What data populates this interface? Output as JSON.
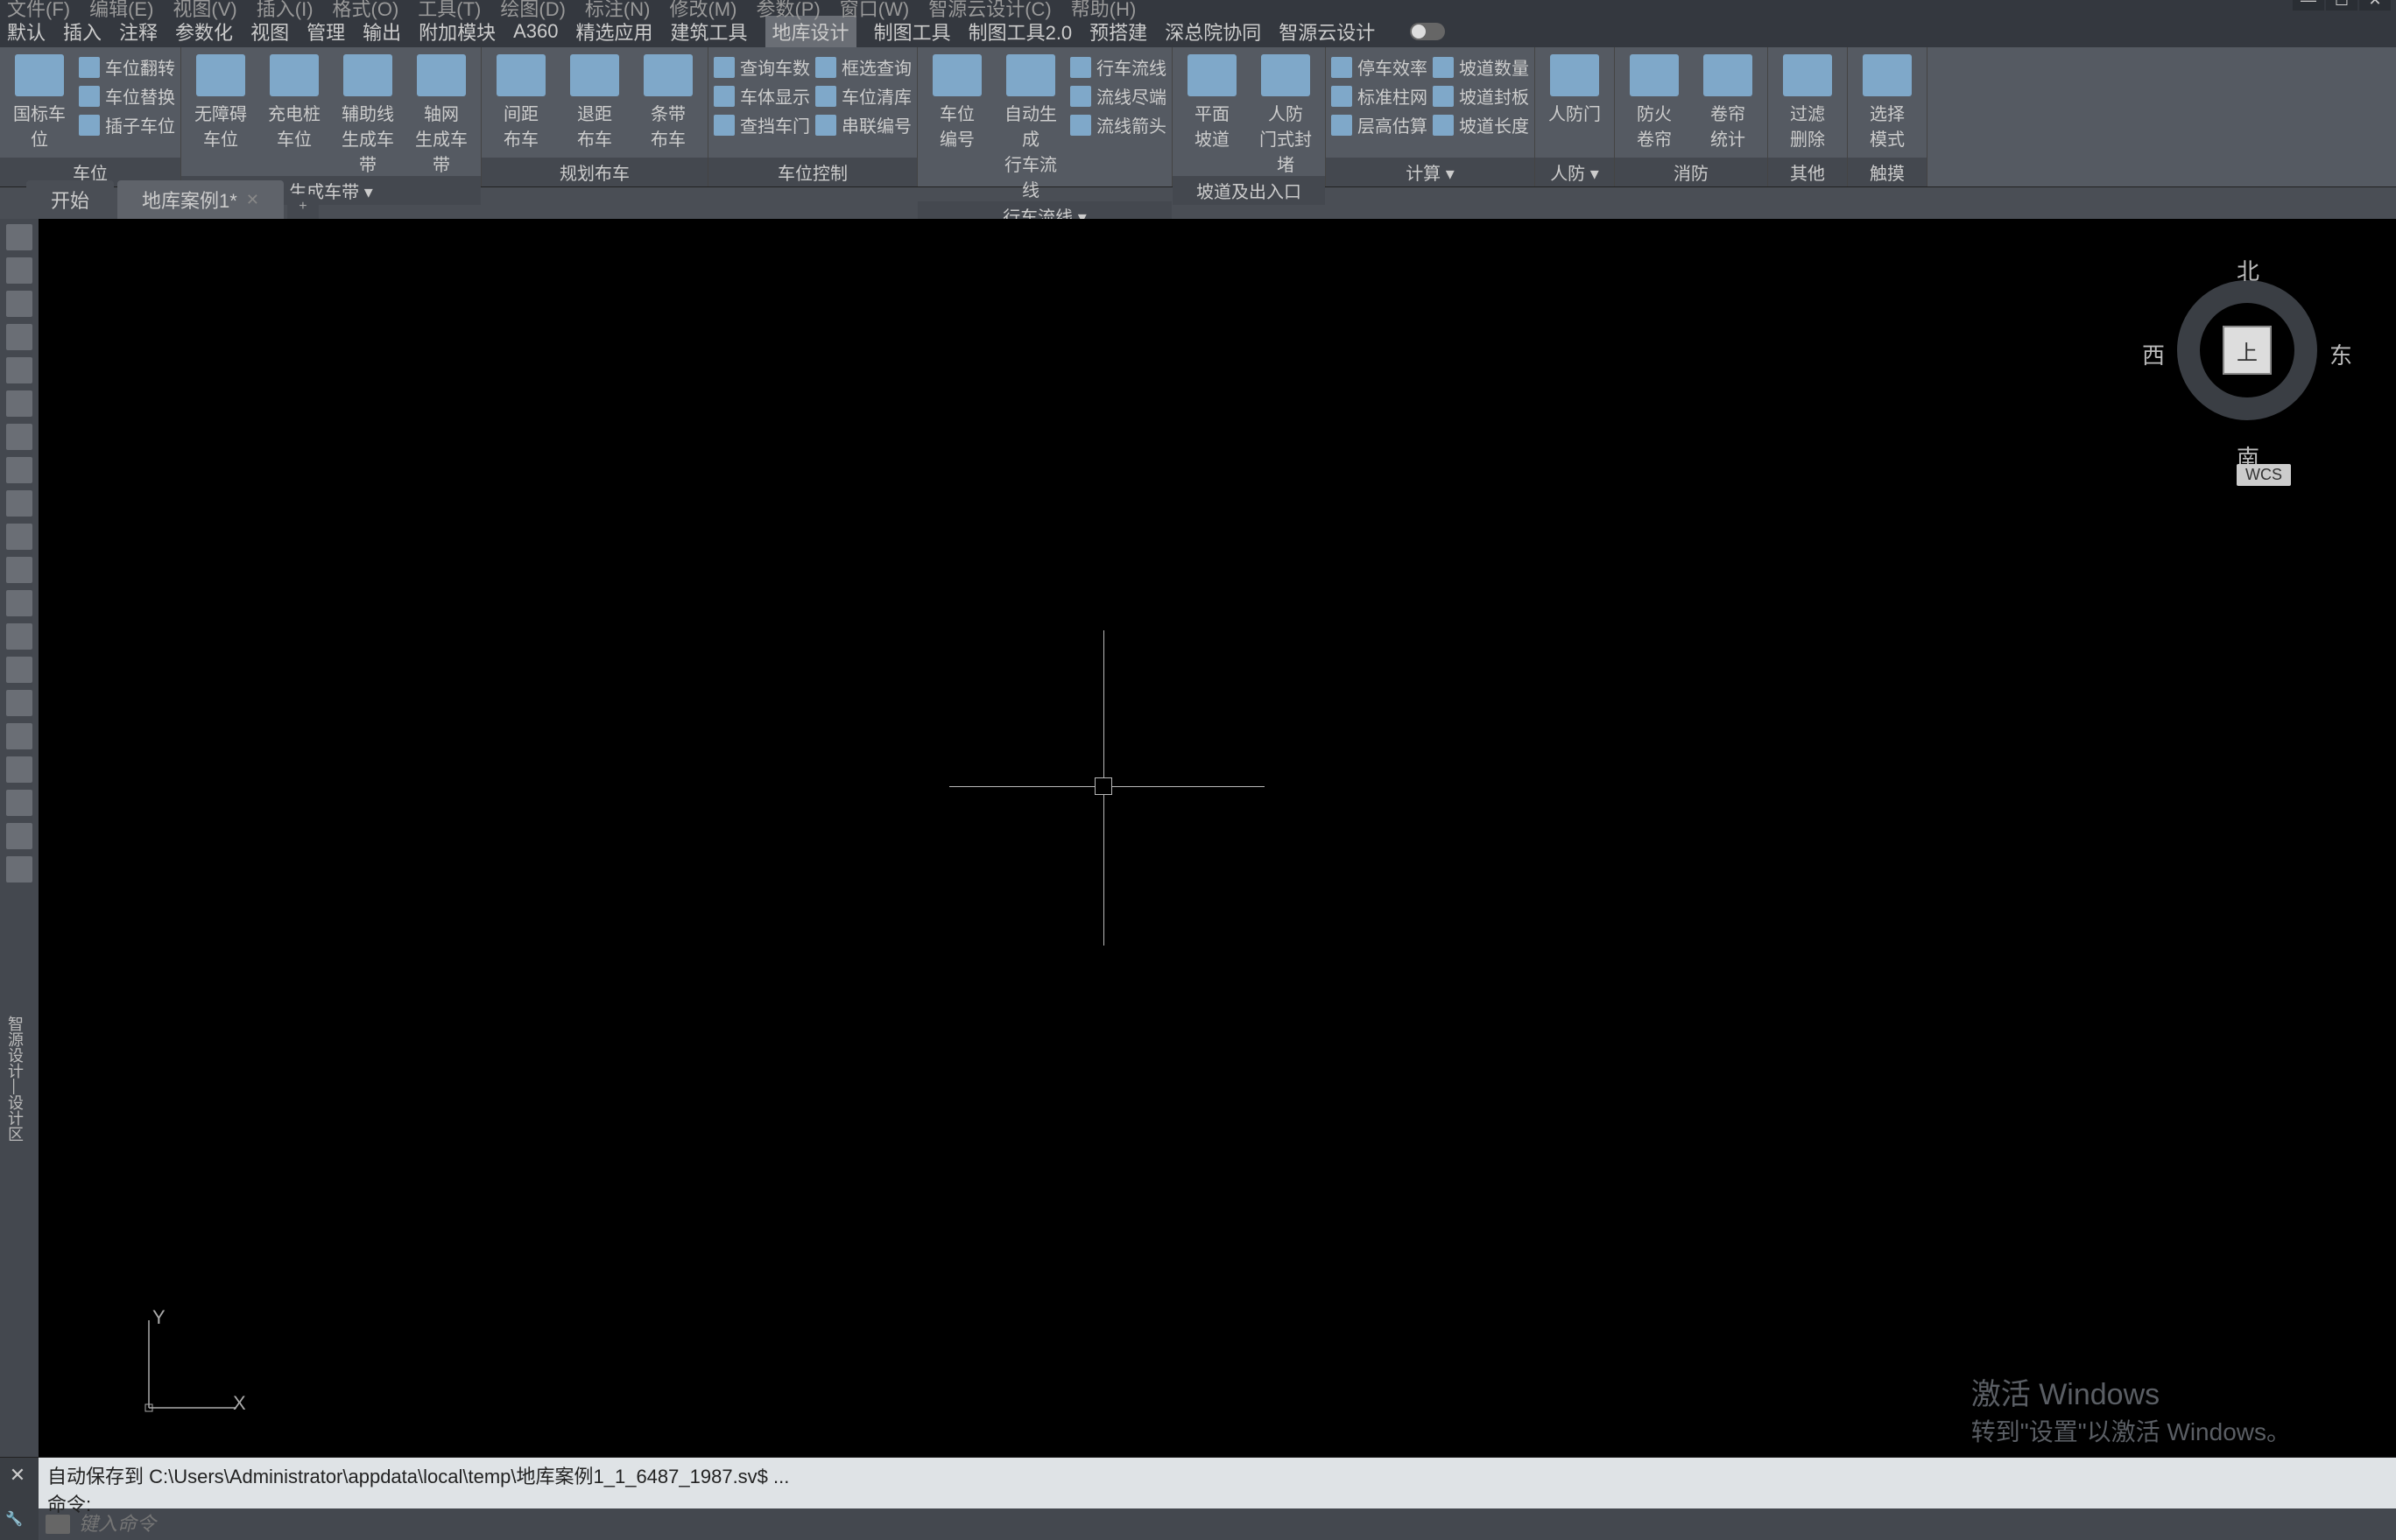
{
  "top_menu": [
    "文件(F)",
    "编辑(E)",
    "视图(V)",
    "插入(I)",
    "格式(O)",
    "工具(T)",
    "绘图(D)",
    "标注(N)",
    "修改(M)",
    "参数(P)",
    "窗口(W)",
    "智源云设计(C)",
    "帮助(H)"
  ],
  "ribbon_tabs": [
    "默认",
    "插入",
    "注释",
    "参数化",
    "视图",
    "管理",
    "输出",
    "附加模块",
    "A360",
    "精选应用",
    "建筑工具",
    "地库设计",
    "制图工具",
    "制图工具2.0",
    "预搭建",
    "深总院协同",
    "智源云设计"
  ],
  "active_ribbon_tab": "地库设计",
  "panels": [
    {
      "title": "车位",
      "big": [
        {
          "label": "国标车位"
        }
      ],
      "small": [
        [
          "车位翻转",
          "车位替换",
          "插子车位"
        ]
      ]
    },
    {
      "title": "生成车带 ▾",
      "big": [
        {
          "label": "无障碍\n车位"
        },
        {
          "label": "充电桩\n车位"
        },
        {
          "label": "辅助线\n生成车带"
        },
        {
          "label": "轴网\n生成车带"
        }
      ],
      "small": []
    },
    {
      "title": "规划布车",
      "big": [
        {
          "label": "间距\n布车"
        },
        {
          "label": "退距\n布车"
        },
        {
          "label": "条带\n布车"
        }
      ],
      "small": []
    },
    {
      "title": "车位控制",
      "big": [],
      "small": [
        [
          "查询车数",
          "车体显示",
          "查挡车门"
        ],
        [
          "框选查询",
          "车位清库",
          "串联编号"
        ]
      ]
    },
    {
      "title": "行车流线 ▾",
      "big": [
        {
          "label": "车位\n编号"
        },
        {
          "label": "自动生成\n行车流线"
        }
      ],
      "small": [
        [
          "行车流线",
          "流线尽端",
          "流线箭头"
        ]
      ]
    },
    {
      "title": "坡道及出入口",
      "big": [
        {
          "label": "平面\n坡道"
        },
        {
          "label": "人防\n门式封堵"
        }
      ],
      "small": []
    },
    {
      "title": "计算 ▾",
      "big": [],
      "small": [
        [
          "停车效率",
          "标准柱网",
          "层高估算"
        ],
        [
          "坡道数量",
          "坡道封板",
          "坡道长度"
        ]
      ]
    },
    {
      "title": "人防 ▾",
      "big": [
        {
          "label": "人防门"
        }
      ],
      "small": []
    },
    {
      "title": "消防",
      "big": [
        {
          "label": "防火\n卷帘"
        },
        {
          "label": "卷帘\n统计"
        }
      ],
      "small": []
    },
    {
      "title": "其他",
      "big": [
        {
          "label": "过滤\n删除"
        }
      ],
      "small": []
    },
    {
      "title": "触摸",
      "big": [
        {
          "label": "选择\n模式"
        }
      ],
      "small": []
    }
  ],
  "doc_tabs": [
    {
      "label": "开始",
      "closable": false
    },
    {
      "label": "地库案例1*",
      "closable": true
    }
  ],
  "viewcube": {
    "n": "北",
    "s": "南",
    "e": "东",
    "w": "西",
    "face": "上",
    "wcs": "WCS"
  },
  "ucs": {
    "y": "Y",
    "x": "X"
  },
  "cmd_history_line1": "自动保存到  C:\\Users\\Administrator\\appdata\\local\\temp\\地库案例1_1_6487_1987.sv$  ...",
  "cmd_history_line2": "命令:",
  "cmd_placeholder": "键入命令",
  "watermark": {
    "l1": "激活 Windows",
    "l2": "转到\"设置\"以激活 Windows。"
  },
  "vtext_label": "智源设计—设计区"
}
